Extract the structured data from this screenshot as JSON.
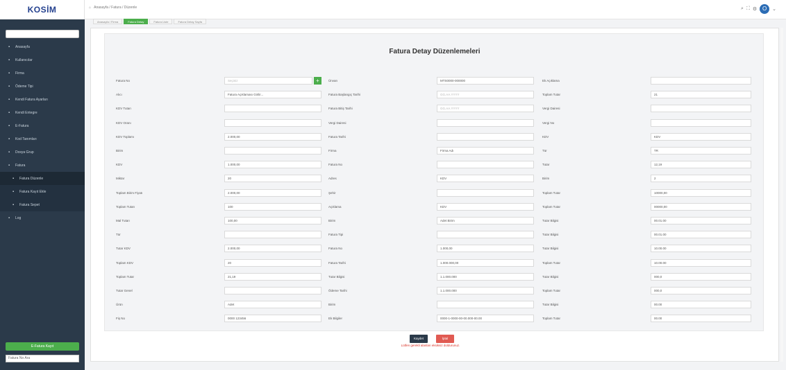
{
  "header": {
    "logo": "KOSİM",
    "breadcrumb": "Anasayfa / Fatura / Düzenle",
    "avatar": "O"
  },
  "tabs": [
    {
      "label": "Anasayfa / Firma"
    },
    {
      "label": "Fatura Detay",
      "active": true
    },
    {
      "label": "Fatura Liste"
    },
    {
      "label": "Fatura Detay Sayfa"
    }
  ],
  "sidebar": {
    "items": [
      {
        "label": "Anasayfa"
      },
      {
        "label": "Kullanıcılar"
      },
      {
        "label": "Firma"
      },
      {
        "label": "Ödeme Tipi"
      },
      {
        "label": "Kendi Fatura Ayarları"
      },
      {
        "label": "Kendi Entegre"
      },
      {
        "label": "E-Fatura"
      },
      {
        "label": "Kod Tanımları"
      },
      {
        "label": "Dosya Grup"
      },
      {
        "label": "Fatura"
      },
      {
        "label": "Fatura Düzenle",
        "sub": true,
        "active": true
      },
      {
        "label": "Fatura Kayıt Ekle",
        "sub": true
      },
      {
        "label": "Fatura Sepet",
        "sub": true
      },
      {
        "label": "Log"
      }
    ],
    "bottom_button": "E-Fatura Kayıt",
    "bottom_input": "Fatura No Ara"
  },
  "form": {
    "title": "Fatura Detay Düzenlemeleri",
    "columns": [
      [
        {
          "label": "Fatura No",
          "value": "",
          "placeholder": "Seçiniz",
          "has_button": true
        },
        {
          "label": "Alıcı",
          "value": "Fatura Açıklaması Girilir..."
        },
        {
          "label": "KDV Tutarı",
          "value": ""
        },
        {
          "label": "KDV Oranı",
          "value": ""
        },
        {
          "label": "KDV Toplamı",
          "value": "2.000,00"
        },
        {
          "label": "Birim",
          "value": ""
        },
        {
          "label": "KDV",
          "value": "1.000,00"
        },
        {
          "label": "Miktar",
          "value": "20"
        },
        {
          "label": "Toplam Birim Fiyatı",
          "value": "2.000,00"
        },
        {
          "label": "Toplam Tutarı",
          "value": "100"
        },
        {
          "label": "Mal Tutarı",
          "value": "100,00"
        },
        {
          "label": "Tür",
          "value": ""
        },
        {
          "label": "Tutar KDV",
          "value": "2.000,00"
        },
        {
          "label": "Toplam KDV",
          "value": "20"
        },
        {
          "label": "Toplam Tutar",
          "value": "21,19"
        },
        {
          "label": "Tutar Genel",
          "value": ""
        },
        {
          "label": "Ürün",
          "value": "Adet"
        },
        {
          "label": "Fiş No",
          "value": "0000 123456"
        }
      ],
      [
        {
          "label": "Ünvan",
          "value": "MTS0000-000000"
        },
        {
          "label": "Fatura Başlangıç Tarihi",
          "value": "",
          "placeholder": "GG.AA.YYYY"
        },
        {
          "label": "Fatura Bitiş Tarihi",
          "value": "",
          "placeholder": "GG.AA.YYYY"
        },
        {
          "label": "Vergi Dairesi",
          "value": ""
        },
        {
          "label": "Fatura Tarihi",
          "value": ""
        },
        {
          "label": "Firma",
          "value": "Firma Adı"
        },
        {
          "label": "Fatura No",
          "value": ""
        },
        {
          "label": "Adres",
          "value": "KDV"
        },
        {
          "label": "Şehir",
          "value": ""
        },
        {
          "label": "Açıklama",
          "value": "KDV"
        },
        {
          "label": "Birim",
          "value": "Adet Birim"
        },
        {
          "label": "Fatura Tipi",
          "value": ""
        },
        {
          "label": "Fatura No",
          "value": "1.000,00"
        },
        {
          "label": "Fatura Tarihi",
          "value": "1.000.000,00"
        },
        {
          "label": "Tutar Bilgisi",
          "value": "1.1.000.000"
        },
        {
          "label": "Ödeme Tarihi",
          "value": "1.1.000.000"
        },
        {
          "label": "Birim",
          "value": ""
        },
        {
          "label": "Ek Bilgiler",
          "value": "0000-1-0000-00-00.000-00.00"
        }
      ],
      [
        {
          "label": "Ek Açıklama",
          "value": ""
        },
        {
          "label": "Toplam Tutar",
          "value": "21"
        },
        {
          "label": "Vergi Dairesi",
          "value": ""
        },
        {
          "label": "Vergi No",
          "value": ""
        },
        {
          "label": "KDV",
          "value": "KDV"
        },
        {
          "label": "Tür",
          "value": "TR"
        },
        {
          "label": "Tutar",
          "value": "12,19"
        },
        {
          "label": "Birim",
          "value": "2"
        },
        {
          "label": "Toplam Tutar",
          "value": "10000,00"
        },
        {
          "label": "Toplam Tutar",
          "value": "00000,00"
        },
        {
          "label": "Tutar Bilgisi",
          "value": "00.01.00"
        },
        {
          "label": "Tutar Bilgisi",
          "value": "00.01.00"
        },
        {
          "label": "Tutar Bilgisi",
          "value": "10.00.00"
        },
        {
          "label": "Toplam Tutar",
          "value": "10.00.00"
        },
        {
          "label": "Tutar Bilgisi",
          "value": "000,0"
        },
        {
          "label": "Toplam Tutar",
          "value": "000,0"
        },
        {
          "label": "Tutar Bilgisi",
          "value": "00.00"
        },
        {
          "label": "Toplam Tutar",
          "value": "00.00"
        }
      ]
    ],
    "save_label": "Kaydet",
    "cancel_label": "İptal",
    "warning": "Lütfen gerekli alanları eksiksiz doldurunuz."
  },
  "colors": {
    "sidebar": "#2b3a4a",
    "accent_green": "#4cae4c",
    "cancel_red": "#e05a52",
    "warning_red": "#d93025"
  }
}
